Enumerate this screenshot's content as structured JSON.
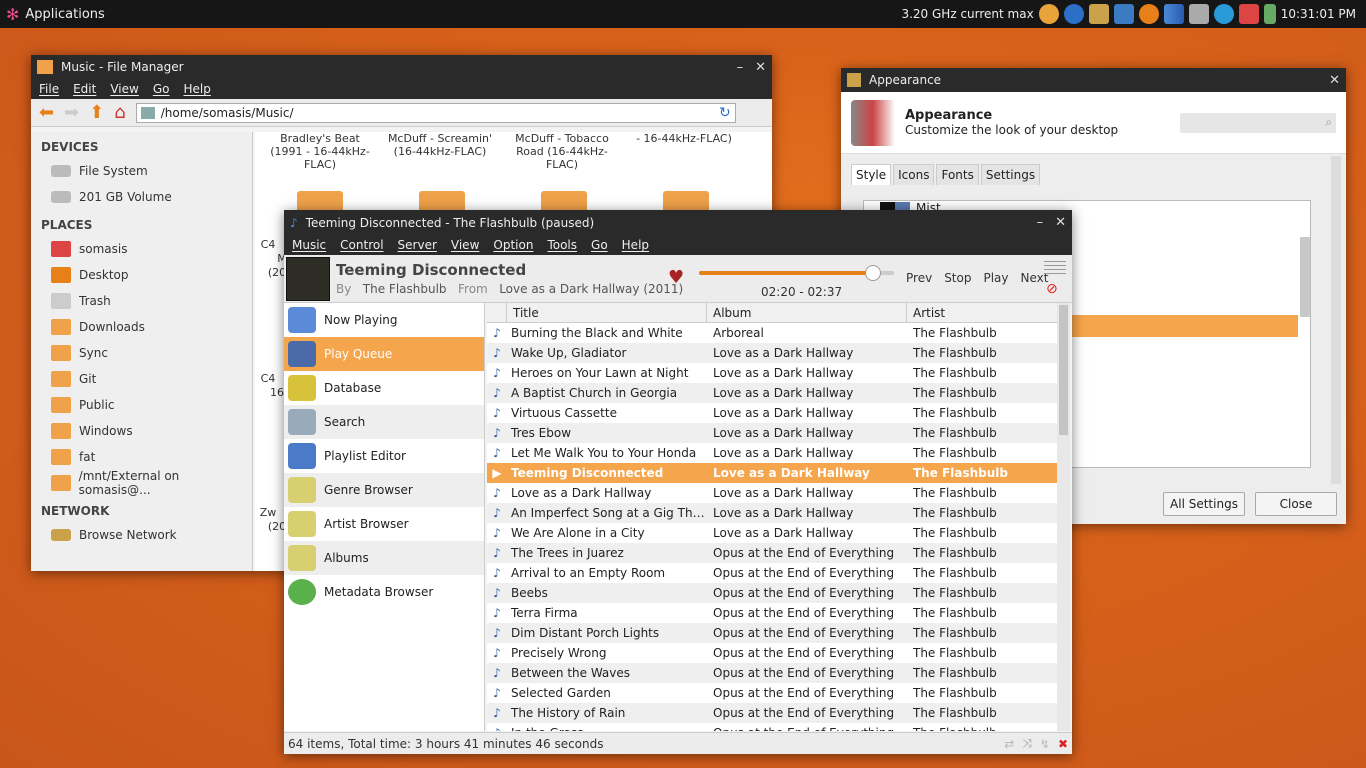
{
  "panel": {
    "apps_label": "Applications",
    "cpu": "3.20 GHz current max",
    "clock": "10:31:01 PM"
  },
  "fm": {
    "title": "Music - File Manager",
    "menu": [
      "File",
      "Edit",
      "View",
      "Go",
      "Help"
    ],
    "path": "/home/somasis/Music/",
    "devices_header": "DEVICES",
    "devices": [
      "File System",
      "201 GB Volume"
    ],
    "places_header": "PLACES",
    "places": [
      "somasis",
      "Desktop",
      "Trash",
      "Downloads",
      "Sync",
      "Git",
      "Public",
      "Windows",
      "fat",
      "/mnt/External on somasis@..."
    ],
    "network_header": "NETWORK",
    "network": [
      "Browse Network"
    ],
    "folders": [
      "Bradley's Beat (1991 - 16-44kHz-FLAC)",
      "McDuff - Screamin' (16-44kHz-FLAC)",
      "McDuff - Tobacco Road (16-44kHz-FLAC)",
      "- 16-44kHz-FLAC)"
    ],
    "partial_labels": [
      "C4",
      "M",
      "(20",
      "C4",
      "16",
      "Zw",
      "(20"
    ]
  },
  "ap": {
    "title": "Appearance",
    "heading": "Appearance",
    "subheading": "Customize the look of your desktop",
    "tabs": [
      "Style",
      "Icons",
      "Fonts",
      "Settings"
    ],
    "first_item": "Mist",
    "all_settings": "All Settings",
    "close": "Close"
  },
  "mp": {
    "title": "Teeming Disconnected - The Flashbulb (paused)",
    "menu": [
      "Music",
      "Control",
      "Server",
      "View",
      "Option",
      "Tools",
      "Go",
      "Help"
    ],
    "song": "Teeming Disconnected",
    "by_label": "By",
    "artist": "The Flashbulb",
    "from_label": "From",
    "album": "Love as a Dark Hallway (2011)",
    "time": "02:20 - 02:37",
    "progress": 0.89,
    "controls": [
      "Prev",
      "Stop",
      "Play",
      "Next"
    ],
    "nav": [
      "Now Playing",
      "Play Queue",
      "Database",
      "Search",
      "Playlist Editor",
      "Genre Browser",
      "Artist Browser",
      "Albums",
      "Metadata Browser"
    ],
    "columns": [
      "Title",
      "Album",
      "Artist"
    ],
    "rows": [
      [
        "Burning the Black and White",
        "Arboreal",
        "The Flashbulb"
      ],
      [
        "Wake Up, Gladiator",
        "Love as a Dark Hallway",
        "The Flashbulb"
      ],
      [
        "Heroes on Your Lawn at Night",
        "Love as a Dark Hallway",
        "The Flashbulb"
      ],
      [
        "A Baptist Church in Georgia",
        "Love as a Dark Hallway",
        "The Flashbulb"
      ],
      [
        "Virtuous Cassette",
        "Love as a Dark Hallway",
        "The Flashbulb"
      ],
      [
        "Tres Ebow",
        "Love as a Dark Hallway",
        "The Flashbulb"
      ],
      [
        "Let Me Walk You to Your Honda",
        "Love as a Dark Hallway",
        "The Flashbulb"
      ],
      [
        "Teeming Disconnected",
        "Love as a Dark Hallway",
        "The Flashbulb"
      ],
      [
        "Love as a Dark Hallway",
        "Love as a Dark Hallway",
        "The Flashbulb"
      ],
      [
        "An Imperfect Song at a Gig That ...",
        "Love as a Dark Hallway",
        "The Flashbulb"
      ],
      [
        "We Are Alone in a City",
        "Love as a Dark Hallway",
        "The Flashbulb"
      ],
      [
        "The Trees in Juarez",
        "Opus at the End of Everything",
        "The Flashbulb"
      ],
      [
        "Arrival to an Empty Room",
        "Opus at the End of Everything",
        "The Flashbulb"
      ],
      [
        "Beebs",
        "Opus at the End of Everything",
        "The Flashbulb"
      ],
      [
        "Terra Firma",
        "Opus at the End of Everything",
        "The Flashbulb"
      ],
      [
        "Dim Distant Porch Lights",
        "Opus at the End of Everything",
        "The Flashbulb"
      ],
      [
        "Precisely Wrong",
        "Opus at the End of Everything",
        "The Flashbulb"
      ],
      [
        "Between the Waves",
        "Opus at the End of Everything",
        "The Flashbulb"
      ],
      [
        "Selected Garden",
        "Opus at the End of Everything",
        "The Flashbulb"
      ],
      [
        "The History of Rain",
        "Opus at the End of Everything",
        "The Flashbulb"
      ],
      [
        "In the Grass",
        "Opus at the End of Everything",
        "The Flashbulb"
      ]
    ],
    "current_index": 7,
    "status": "64 items, Total time: 3 hours 41 minutes 46 seconds"
  }
}
